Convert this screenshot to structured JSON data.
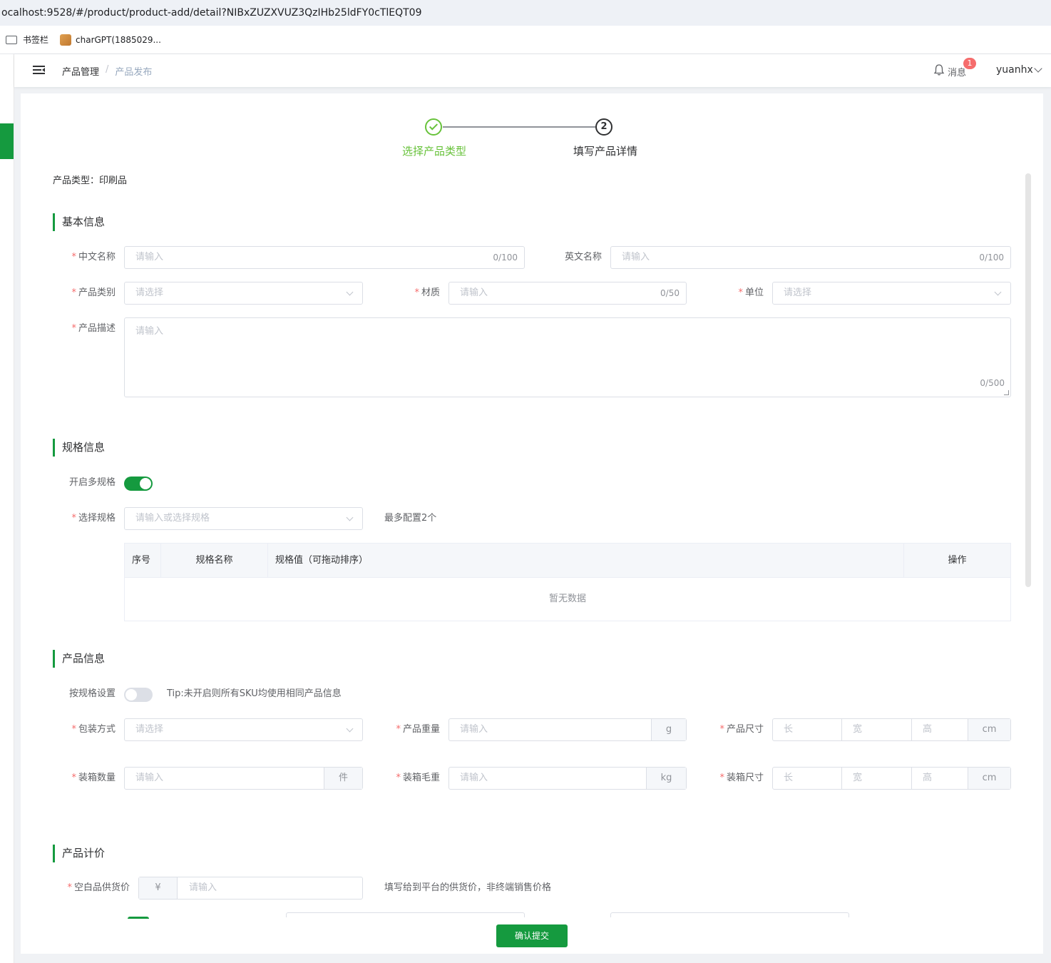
{
  "browser": {
    "url": "ocalhost:9528/#/product/product-add/detail?NIBxZUZXVUZ3QzIHb25ldFY0cTlEQT09",
    "bookmarks": [
      {
        "label": "书签栏",
        "icon": "folder-icon"
      },
      {
        "label": "charGPT(1885029...",
        "icon": "site-favicon"
      }
    ]
  },
  "header": {
    "breadcrumb": [
      "产品管理",
      "产品发布"
    ],
    "breadcrumb_sep": "/",
    "messages_label": "消息",
    "messages_count": "1",
    "username": "yuanhx"
  },
  "steps": [
    {
      "label": "选择产品类型",
      "status": "done"
    },
    {
      "label": "填写产品详情",
      "number": "2",
      "status": "current"
    }
  ],
  "product_type_line": "产品类型：印刷品",
  "basic": {
    "title": "基本信息",
    "cn_name": {
      "label": "中文名称",
      "placeholder": "请输入",
      "count": "0/100"
    },
    "en_name": {
      "label": "英文名称",
      "placeholder": "请输入",
      "count": "0/100"
    },
    "category": {
      "label": "产品类别",
      "placeholder": "请选择"
    },
    "material": {
      "label": "材质",
      "placeholder": "请输入",
      "count": "0/50"
    },
    "unit": {
      "label": "单位",
      "placeholder": "请选择"
    },
    "desc": {
      "label": "产品描述",
      "placeholder": "请输入",
      "count": "0/500"
    }
  },
  "spec": {
    "title": "规格信息",
    "multi_label": "开启多规格",
    "multi_on": true,
    "select_label": "选择规格",
    "select_placeholder": "请输入或选择规格",
    "select_hint": "最多配置2个",
    "table_headers": [
      "序号",
      "规格名称",
      "规格值（可拖动排序）",
      "操作"
    ],
    "table_empty": "暂无数据"
  },
  "info": {
    "title": "产品信息",
    "by_spec_label": "按规格设置",
    "by_spec_on": false,
    "tip": "Tip:未开启则所有SKU均使用相同产品信息",
    "packing": {
      "label": "包装方式",
      "placeholder": "请选择"
    },
    "weight": {
      "label": "产品重量",
      "placeholder": "请输入",
      "unit": "g"
    },
    "size": {
      "label": "产品尺寸",
      "l": "长",
      "w": "宽",
      "h": "高",
      "unit": "cm"
    },
    "box_qty": {
      "label": "装箱数量",
      "placeholder": "请输入",
      "unit": "件"
    },
    "box_weight": {
      "label": "装箱毛重",
      "placeholder": "请输入",
      "unit": "kg"
    },
    "box_size": {
      "label": "装箱尺寸",
      "l": "长",
      "w": "宽",
      "h": "高",
      "unit": "cm"
    }
  },
  "pricing": {
    "title": "产品计价",
    "supply": {
      "label": "空白品供货价",
      "prefix": "¥",
      "placeholder": "请输入",
      "hint": "填写给到平台的供货价，非终端销售价格"
    }
  },
  "submit_label": "确认提交",
  "colors": {
    "primary": "#159a3f",
    "success": "#67c23a",
    "required": "#f56c6c"
  }
}
